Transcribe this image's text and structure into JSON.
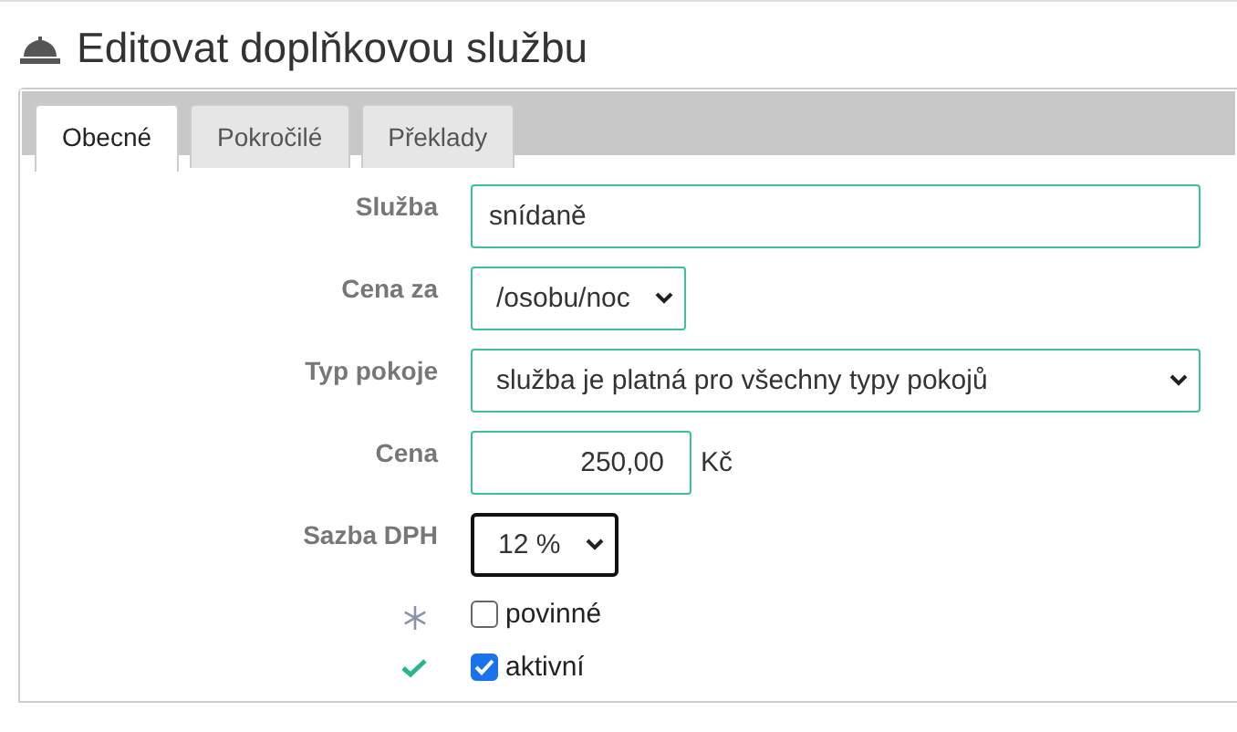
{
  "title": "Editovat doplňkovou službu",
  "tabs": [
    {
      "label": "Obecné",
      "selected": true
    },
    {
      "label": "Pokročilé",
      "selected": false
    },
    {
      "label": "Překlady",
      "selected": false
    }
  ],
  "fields": [
    {
      "label": "Služba",
      "kind": "text",
      "value": "snídaně",
      "focused": false
    },
    {
      "label": "Cena za",
      "kind": "select",
      "value": "/osobu/noc",
      "focused": false
    },
    {
      "label": "Typ pokoje",
      "kind": "select",
      "value": "služba je platná pro všechny typy pokojů",
      "focused": false
    },
    {
      "label": "Cena",
      "kind": "number",
      "value": "250,00",
      "unit": "Kč",
      "focused": false
    },
    {
      "label": "Sazba DPH",
      "kind": "select",
      "value": "12 %",
      "focused": true
    }
  ],
  "checks": [
    {
      "kind": "required",
      "label": "povinné",
      "checked": false
    },
    {
      "kind": "active",
      "label": "aktivní",
      "checked": true
    }
  ]
}
